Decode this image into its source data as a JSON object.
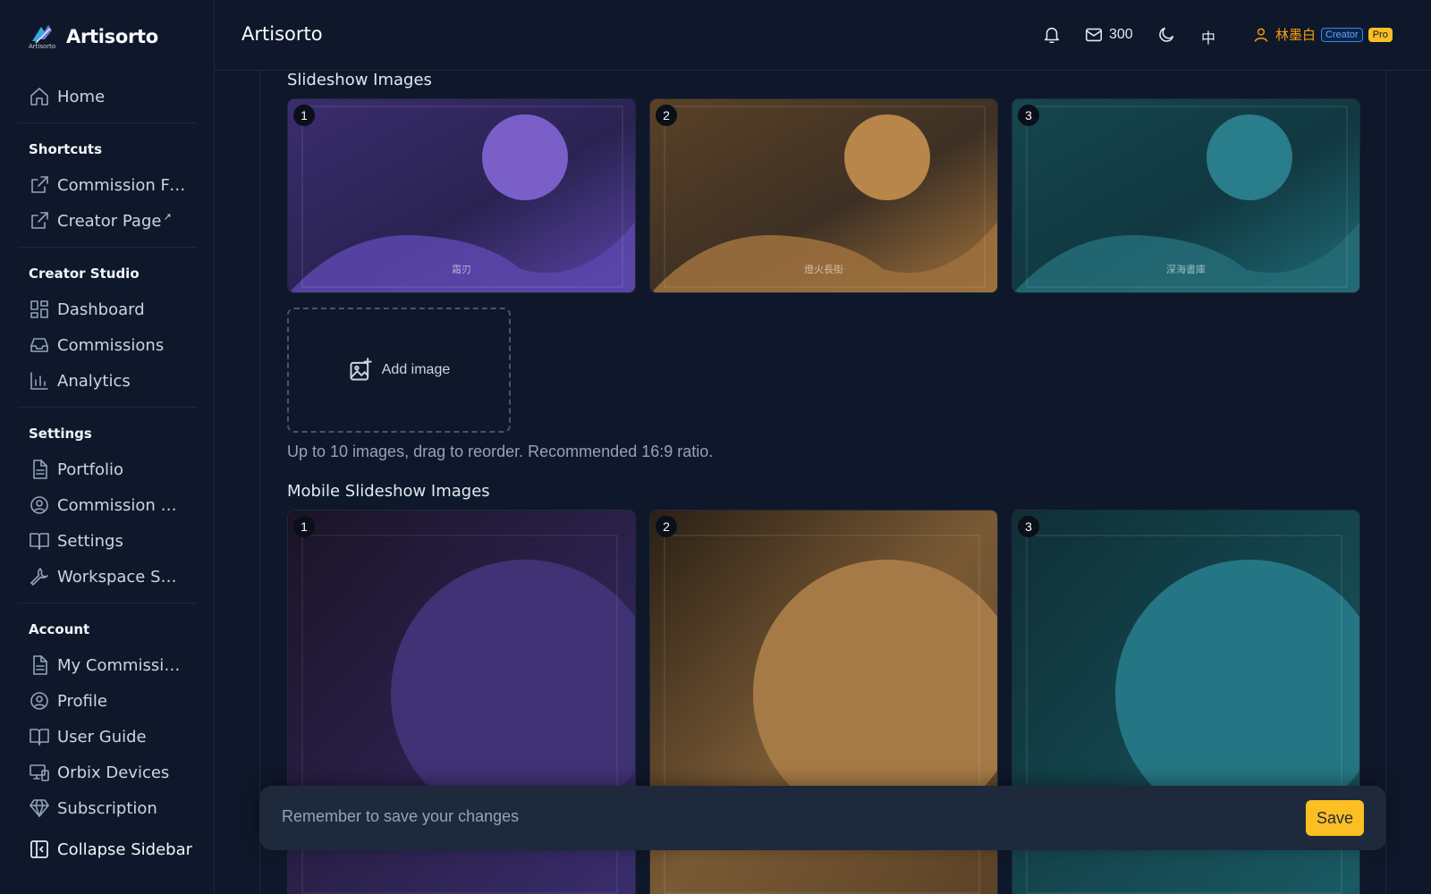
{
  "app": {
    "logo_caption": "Artisorto",
    "brand_name": "Artisorto",
    "header_title": "Artisorto"
  },
  "sidebar": {
    "home": "Home",
    "sections": {
      "shortcuts": "Shortcuts",
      "creator_studio": "Creator Studio",
      "settings": "Settings",
      "account": "Account"
    },
    "shortcuts": [
      {
        "label": "Commission Fo...",
        "icon": "external-link-icon"
      },
      {
        "label": "Creator Page",
        "icon": "external-link-icon",
        "suffix": "↗"
      }
    ],
    "creator_studio": [
      {
        "label": "Dashboard",
        "icon": "dashboard-icon"
      },
      {
        "label": "Commissions",
        "icon": "inbox-icon"
      },
      {
        "label": "Analytics",
        "icon": "bar-chart-icon"
      }
    ],
    "settings": [
      {
        "label": "Portfolio",
        "icon": "document-icon"
      },
      {
        "label": "Commission Se...",
        "icon": "user-circle-icon"
      },
      {
        "label": "Settings",
        "icon": "book-icon"
      },
      {
        "label": "Workspace Set...",
        "icon": "wrench-icon"
      }
    ],
    "account": [
      {
        "label": "My Commissions",
        "icon": "document-icon"
      },
      {
        "label": "Profile",
        "icon": "user-circle-icon"
      },
      {
        "label": "User Guide",
        "icon": "book-icon"
      },
      {
        "label": "Orbix Devices",
        "icon": "devices-icon"
      },
      {
        "label": "Subscription",
        "icon": "diamond-icon"
      }
    ],
    "collapse": "Collapse Sidebar"
  },
  "header": {
    "mail_count": "300",
    "language": "中",
    "user_name": "林墨白",
    "badge_creator": "Creator",
    "badge_pro": "Pro"
  },
  "main": {
    "slideshow_title": "Slideshow Images",
    "slides": [
      {
        "number": "1",
        "caption": "霜刃",
        "color": "#6d54b8"
      },
      {
        "number": "2",
        "caption": "燈火長街",
        "color": "#b8864a"
      },
      {
        "number": "3",
        "caption": "深海書庫",
        "color": "#2a7d8a"
      }
    ],
    "add_image": "Add image",
    "hint": "Up to 10 images, drag to reorder. Recommended 16:9 ratio.",
    "mobile_title": "Mobile Slideshow Images",
    "mobile_slides": [
      {
        "number": "1",
        "color": "#6d54b8"
      },
      {
        "number": "2",
        "color": "#b8864a"
      },
      {
        "number": "3",
        "color": "#2a7d8a"
      }
    ]
  },
  "savebar": {
    "message": "Remember to save your changes",
    "save_label": "Save"
  },
  "colors": {
    "background": "#0f172a",
    "accent": "#fbbf24",
    "user_accent": "#f59e0b",
    "panel": "#1e293b"
  }
}
